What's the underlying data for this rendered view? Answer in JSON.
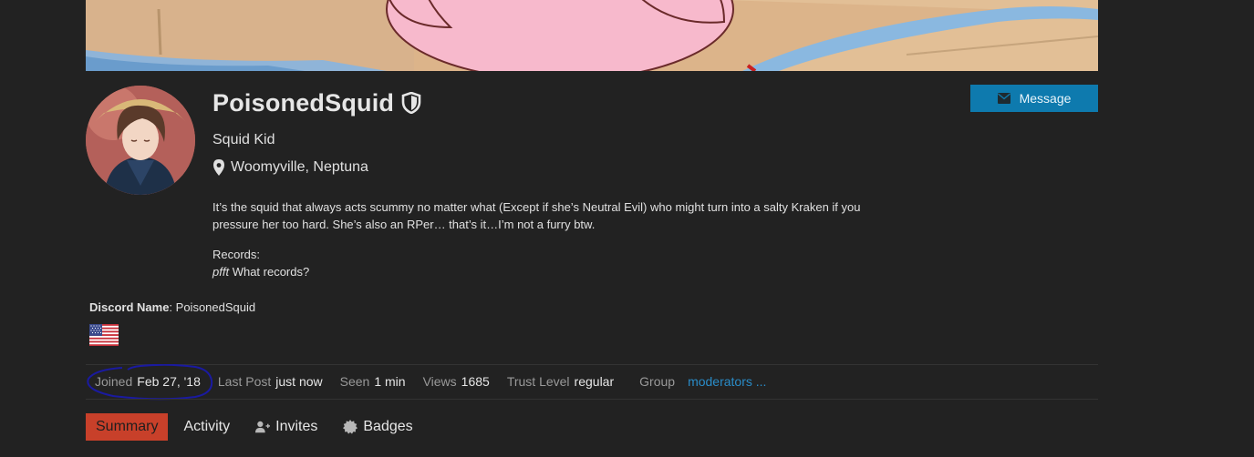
{
  "profile": {
    "username": "PoisonedSquid",
    "title": "Squid Kid",
    "location": "Woomyville, Neptuna",
    "bio": "It’s the squid that always acts scummy no matter what (Except if she’s Neutral Evil) who might turn into a salty Kraken if you pressure her too hard. She’s also an RPer… that’s it…I’m not a furry btw.",
    "records_label": "Records:",
    "records_emph": "pfft",
    "records_text": " What records?",
    "message_label": "Message",
    "discord_label": "Discord Name",
    "discord_sep": ": ",
    "discord_value": "PoisonedSquid"
  },
  "stats": {
    "joined_label": "Joined",
    "joined_value": "Feb 27, '18",
    "last_post_label": "Last Post",
    "last_post_value": "just now",
    "seen_label": "Seen",
    "seen_value": "1 min",
    "views_label": "Views",
    "views_value": "1685",
    "trust_label": "Trust Level",
    "trust_value": "regular",
    "group_label": "Group",
    "group_value": "moderators ..."
  },
  "nav": {
    "summary": "Summary",
    "activity": "Activity",
    "invites": "Invites",
    "badges": "Badges"
  },
  "icons": {
    "shield": "shield-icon",
    "location": "map-marker-icon",
    "message": "envelope-icon",
    "invites": "user-plus-icon",
    "badges": "certificate-icon"
  },
  "colors": {
    "background": "#222222",
    "accent_blue": "#0e7aae",
    "link_blue": "#2a8cc8",
    "active_tab": "#c8402a"
  }
}
